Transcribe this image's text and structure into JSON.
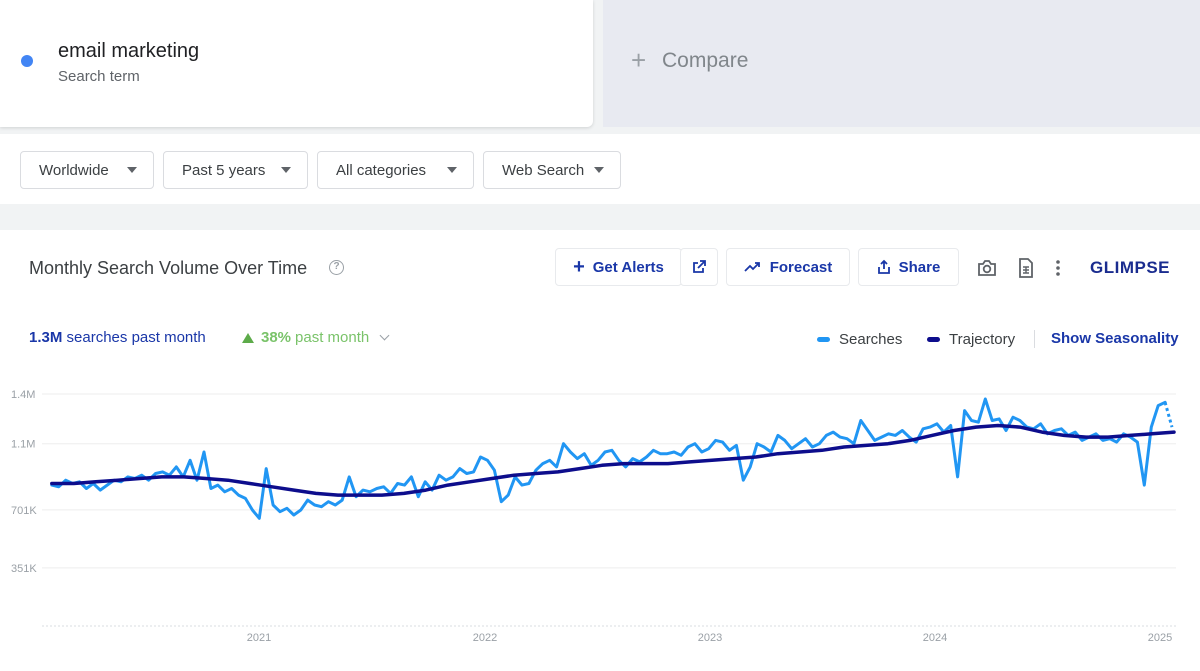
{
  "search_term": {
    "name": "email marketing",
    "subtitle": "Search term",
    "color": "#4285f4"
  },
  "compare": {
    "label": "Compare"
  },
  "filters": [
    {
      "label": "Worldwide"
    },
    {
      "label": "Past 5 years"
    },
    {
      "label": "All categories"
    },
    {
      "label": "Web Search"
    }
  ],
  "panel": {
    "title": "Monthly Search Volume Over Time",
    "buttons": {
      "get_alerts": "Get Alerts",
      "forecast": "Forecast",
      "share": "Share"
    },
    "icons": [
      "plus-icon",
      "external-link-icon",
      "trend-up-icon",
      "share-icon",
      "camera-icon",
      "csv-icon",
      "more-vert-icon",
      "help-icon"
    ],
    "logo": "GLIMPSE"
  },
  "stats": {
    "volume_value": "1.3M",
    "volume_text": "searches past month",
    "growth_value": "38%",
    "growth_text": "past month"
  },
  "legend": {
    "searches": "Searches",
    "trajectory": "Trajectory",
    "seasonality": "Show Seasonality"
  },
  "colors": {
    "searches": "#2196f3",
    "trajectory": "#0d0d8c",
    "accent": "#1a37a8",
    "growth": "#7ac36a"
  },
  "chart_data": {
    "type": "line",
    "y_ticks": [
      "1.4M",
      "1.1M",
      "701K",
      "351K"
    ],
    "y_tick_values": [
      1400000,
      1100000,
      701000,
      351000
    ],
    "x_ticks": [
      "2021",
      "2022",
      "2023",
      "2024",
      "2025"
    ],
    "ylim": [
      0,
      1400000
    ],
    "x_range": [
      "2020-02",
      "2025-03"
    ],
    "grid": true,
    "legend_position": "top-right",
    "series": [
      {
        "name": "Searches",
        "x_start": "2020-02",
        "x_step": "week",
        "values": [
          850000,
          840000,
          880000,
          860000,
          870000,
          830000,
          860000,
          820000,
          850000,
          880000,
          870000,
          900000,
          890000,
          910000,
          880000,
          920000,
          930000,
          910000,
          960000,
          900000,
          1000000,
          880000,
          1050000,
          830000,
          850000,
          810000,
          830000,
          790000,
          770000,
          700000,
          650000,
          950000,
          730000,
          690000,
          710000,
          670000,
          700000,
          760000,
          730000,
          720000,
          750000,
          730000,
          760000,
          900000,
          780000,
          820000,
          810000,
          830000,
          840000,
          800000,
          860000,
          850000,
          900000,
          780000,
          870000,
          820000,
          910000,
          880000,
          900000,
          950000,
          920000,
          930000,
          1020000,
          1000000,
          940000,
          750000,
          790000,
          900000,
          850000,
          860000,
          940000,
          980000,
          1000000,
          960000,
          1100000,
          1050000,
          1010000,
          1040000,
          970000,
          1000000,
          1050000,
          1060000,
          1000000,
          960000,
          1010000,
          990000,
          1020000,
          1060000,
          1040000,
          1040000,
          1050000,
          1030000,
          1080000,
          1100000,
          1050000,
          1070000,
          1120000,
          1110000,
          1060000,
          1090000,
          880000,
          960000,
          1100000,
          1080000,
          1050000,
          1150000,
          1120000,
          1070000,
          1100000,
          1130000,
          1080000,
          1100000,
          1150000,
          1170000,
          1140000,
          1130000,
          1100000,
          1240000,
          1180000,
          1120000,
          1140000,
          1160000,
          1150000,
          1180000,
          1140000,
          1110000,
          1190000,
          1200000,
          1220000,
          1170000,
          1210000,
          900000,
          1300000,
          1240000,
          1230000,
          1370000,
          1240000,
          1250000,
          1180000,
          1260000,
          1240000,
          1200000,
          1190000,
          1220000,
          1160000,
          1180000,
          1190000,
          1150000,
          1170000,
          1120000,
          1140000,
          1160000,
          1120000,
          1130000,
          1110000,
          1160000,
          1140000,
          1110000,
          850000,
          1200000,
          1330000,
          1350000,
          1200000
        ]
      },
      {
        "name": "Trajectory",
        "x_start": "2020-02",
        "x_step": "week",
        "values": [
          860000,
          860000,
          870000,
          880000,
          890000,
          900000,
          900000,
          890000,
          880000,
          860000,
          840000,
          820000,
          800000,
          790000,
          790000,
          790000,
          800000,
          820000,
          850000,
          870000,
          890000,
          910000,
          920000,
          930000,
          950000,
          970000,
          980000,
          980000,
          980000,
          990000,
          1000000,
          1010000,
          1020000,
          1040000,
          1050000,
          1060000,
          1080000,
          1090000,
          1100000,
          1120000,
          1150000,
          1180000,
          1200000,
          1210000,
          1200000,
          1170000,
          1150000,
          1140000,
          1140000,
          1150000,
          1160000,
          1170000
        ]
      }
    ]
  }
}
